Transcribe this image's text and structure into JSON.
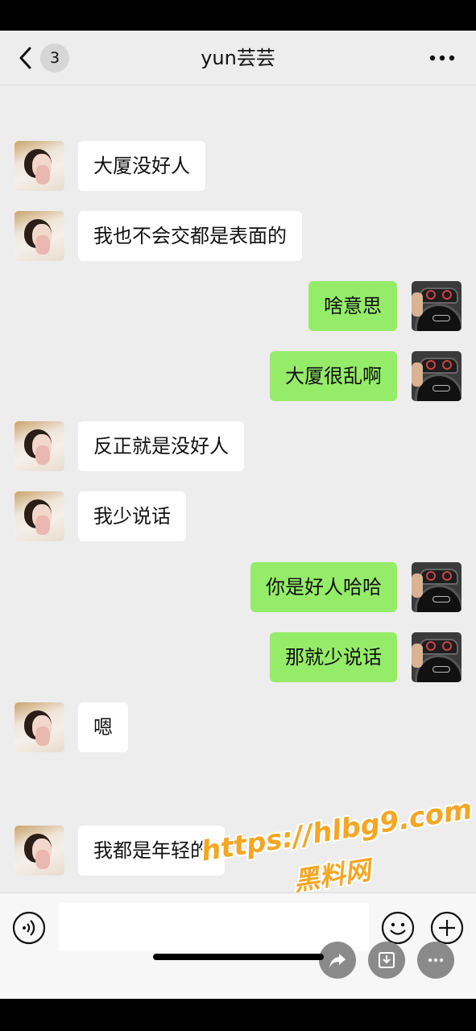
{
  "header": {
    "back_label": "返回",
    "unread_count": "3",
    "title": "yun芸芸",
    "more_icon": "more-dots-icon"
  },
  "messages": [
    {
      "side": "left",
      "text": "大厦没好人"
    },
    {
      "side": "left",
      "text": "我也不会交都是表面的"
    },
    {
      "side": "right",
      "text": "啥意思"
    },
    {
      "side": "right",
      "text": "大厦很乱啊"
    },
    {
      "side": "left",
      "text": "反正就是没好人"
    },
    {
      "side": "left",
      "text": "我少说话"
    },
    {
      "side": "right",
      "text": "你是好人哈哈"
    },
    {
      "side": "right",
      "text": "那就少说话"
    },
    {
      "side": "left",
      "text": "嗯"
    },
    {
      "side": "left",
      "text": "我都是年轻的"
    }
  ],
  "watermark": {
    "url": "https://hlbg9.com",
    "name": "黑料网"
  },
  "input_bar": {
    "text_value": "",
    "icons": [
      "voice-icon",
      "emoji-icon",
      "plus-icon"
    ],
    "floating_actions": [
      "forward-icon",
      "download-icon",
      "more-icon"
    ]
  },
  "colors": {
    "background": "#ededed",
    "bubble_left": "#ffffff",
    "bubble_right": "#95ec69",
    "watermark": "#f5a623"
  }
}
